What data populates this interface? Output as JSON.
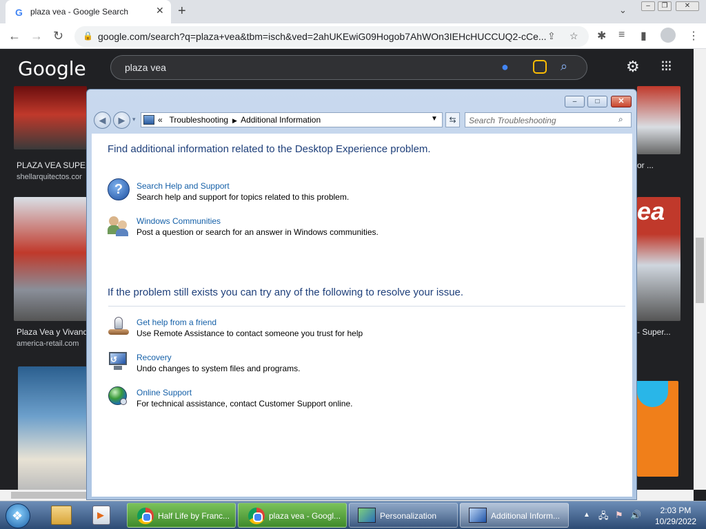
{
  "browser": {
    "tab_title": "plaza vea - Google Search",
    "tab_favicon": "G",
    "url": "google.com/search?q=plaza+vea&tbm=isch&ved=2ahUKEwiG09Hogob7AhWOn3IEHcHUCCUQ2-cCe..."
  },
  "google": {
    "logo": "Google",
    "query": "plaza vea",
    "results": [
      {
        "caption": "PLAZA VEA SUPER",
        "source": "shellarquitectos.cor"
      },
      {
        "caption": "Plaza Vea y Vivand",
        "source": "america-retail.com"
      },
      {
        "caption": "or ...",
        "source": ""
      },
      {
        "caption": "- Super...",
        "source": ""
      }
    ],
    "thumb_text": "ea"
  },
  "dialog": {
    "breadcrumb_sep": "«",
    "breadcrumb_1": "Troubleshooting",
    "breadcrumb_2": "Additional Information",
    "search_placeholder": "Search Troubleshooting",
    "heading_1": "Find additional information related to the Desktop Experience problem.",
    "heading_2": "If the problem still exists you can try any of the following to resolve your issue.",
    "items_top": [
      {
        "title": "Search Help and Support",
        "desc": "Search help and support for topics related to this problem.",
        "icon": "help-icon"
      },
      {
        "title": "Windows Communities",
        "desc": "Post a question or search for an answer in Windows communities.",
        "icon": "people-icon"
      }
    ],
    "items_bottom": [
      {
        "title": "Get help from a friend",
        "desc": "Use Remote Assistance to contact someone you trust for help",
        "icon": "remote-assistance-icon"
      },
      {
        "title": "Recovery",
        "desc": "Undo changes to system files and programs.",
        "icon": "recovery-icon"
      },
      {
        "title": "Online Support",
        "desc": "For technical assistance, contact Customer Support online.",
        "icon": "globe-icon"
      }
    ]
  },
  "taskbar": {
    "items": [
      {
        "label": "Half Life by Franc...",
        "icon": "chrome-icon"
      },
      {
        "label": "plaza vea - Googl...",
        "icon": "chrome-icon"
      },
      {
        "label": "Personalization",
        "icon": "personalization-icon"
      },
      {
        "label": "Additional Inform...",
        "icon": "troubleshooting-icon"
      }
    ],
    "time": "2:03 PM",
    "date": "10/29/2022"
  }
}
